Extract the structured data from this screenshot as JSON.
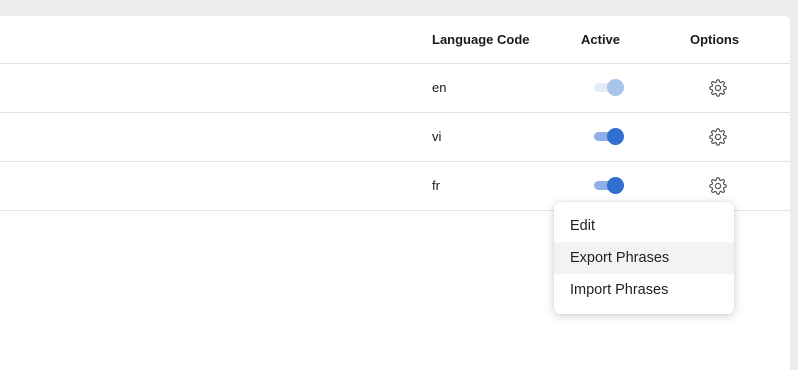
{
  "table": {
    "headers": {
      "language_code": "Language Code",
      "active": "Active",
      "options": "Options"
    },
    "rows": [
      {
        "code": "en",
        "active": false
      },
      {
        "code": "vi",
        "active": true
      },
      {
        "code": "fr",
        "active": true
      }
    ]
  },
  "options_menu": {
    "items": [
      {
        "label": "Edit"
      },
      {
        "label": "Export Phrases",
        "hovered": true
      },
      {
        "label": "Import Phrases"
      }
    ]
  },
  "colors": {
    "toggle_on": "#2e6fd0",
    "toggle_off": "#a9c5ec",
    "page_background": "#ececec"
  }
}
